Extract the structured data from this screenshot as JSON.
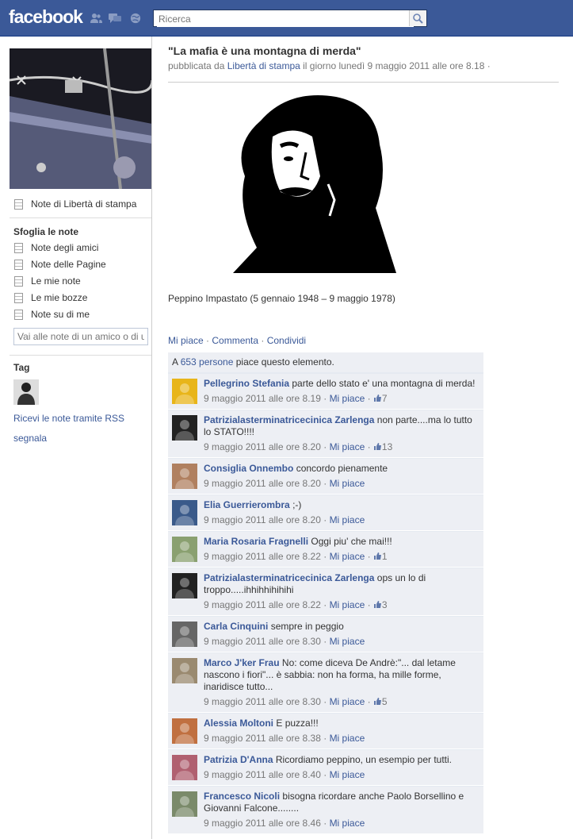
{
  "header": {
    "logo": "facebook",
    "search_placeholder": "Ricerca"
  },
  "sidebar": {
    "notes_of": "Note di Libertà di stampa",
    "browse_heading": "Sfoglia le note",
    "items": [
      "Note degli amici",
      "Note delle Pagine",
      "Le mie note",
      "Le mie bozze",
      "Note su di me"
    ],
    "friend_input_placeholder": "Vai alle note di un amico o di una Pagina",
    "tag_heading": "Tag",
    "rss": "Ricevi le note tramite RSS",
    "report": "segnala"
  },
  "note": {
    "title": "\"La mafia è una montagna di merda\"",
    "meta_prefix": "pubblicata da ",
    "author": "Libertà di stampa",
    "meta_suffix": " il giorno lunedì 9 maggio 2011 alle ore 8.18 ·",
    "caption": "Peppino Impastato (5 gennaio 1948 – 9 maggio 1978)",
    "actions": {
      "like": "Mi piace",
      "comment": "Commenta",
      "share": "Condividi"
    }
  },
  "likes": {
    "prefix": "A ",
    "count": "653 persone",
    "suffix": " piace questo elemento."
  },
  "comments": [
    {
      "author": "Pellegrino Stefania",
      "text": "parte dello stato e' una montagna di merda!",
      "time": "9 maggio 2011 alle ore 8.19",
      "like": "Mi piace",
      "likes": "7",
      "avatar_color": "#e8b51a"
    },
    {
      "author": "Patrizialasterminatricecinica Zarlenga",
      "text": "non parte....ma lo tutto lo STATO!!!!",
      "time": "9 maggio 2011 alle ore 8.20",
      "like": "Mi piace",
      "likes": "13",
      "avatar_color": "#222222"
    },
    {
      "author": "Consiglia Onnembo",
      "text": "concordo pienamente",
      "time": "9 maggio 2011 alle ore 8.20",
      "like": "Mi piace",
      "likes": "",
      "avatar_color": "#b08060"
    },
    {
      "author": "Elia Guerrierombra",
      "text": ";-)",
      "time": "9 maggio 2011 alle ore 8.20",
      "like": "Mi piace",
      "likes": "",
      "avatar_color": "#3a5a8a"
    },
    {
      "author": "Maria Rosaria Fragnelli",
      "text": "Oggi piu' che mai!!!",
      "time": "9 maggio 2011 alle ore 8.22",
      "like": "Mi piace",
      "likes": "1",
      "avatar_color": "#8aa070"
    },
    {
      "author": "Patrizialasterminatricecinica Zarlenga",
      "text": "ops un lo di troppo.....ihhihhihihihi",
      "time": "9 maggio 2011 alle ore 8.22",
      "like": "Mi piace",
      "likes": "3",
      "avatar_color": "#222222"
    },
    {
      "author": "Carla Cinquini",
      "text": "sempre in peggio",
      "time": "9 maggio 2011 alle ore 8.30",
      "like": "Mi piace",
      "likes": "",
      "avatar_color": "#666666"
    },
    {
      "author": "Marco J'ker Frau",
      "text": "No: come diceva De Andrè:\"... dal letame nascono i fiori\"... è sabbia: non ha forma, ha mille forme, inaridisce tutto...",
      "time": "9 maggio 2011 alle ore 8.30",
      "like": "Mi piace",
      "likes": "5",
      "avatar_color": "#9a8a70"
    },
    {
      "author": "Alessia Moltoni",
      "text": "E puzza!!!",
      "time": "9 maggio 2011 alle ore 8.38",
      "like": "Mi piace",
      "likes": "",
      "avatar_color": "#c07040"
    },
    {
      "author": "Patrizia D'Anna",
      "text": "Ricordiamo peppino, un esempio per tutti.",
      "time": "9 maggio 2011 alle ore 8.40",
      "like": "Mi piace",
      "likes": "",
      "avatar_color": "#b06070"
    },
    {
      "author": "Francesco Nicoli",
      "text": "bisogna ricordare anche Paolo Borsellino e Giovanni Falcone........",
      "time": "9 maggio 2011 alle ore 8.46",
      "like": "Mi piace",
      "likes": "",
      "avatar_color": "#7a8a6a"
    }
  ]
}
